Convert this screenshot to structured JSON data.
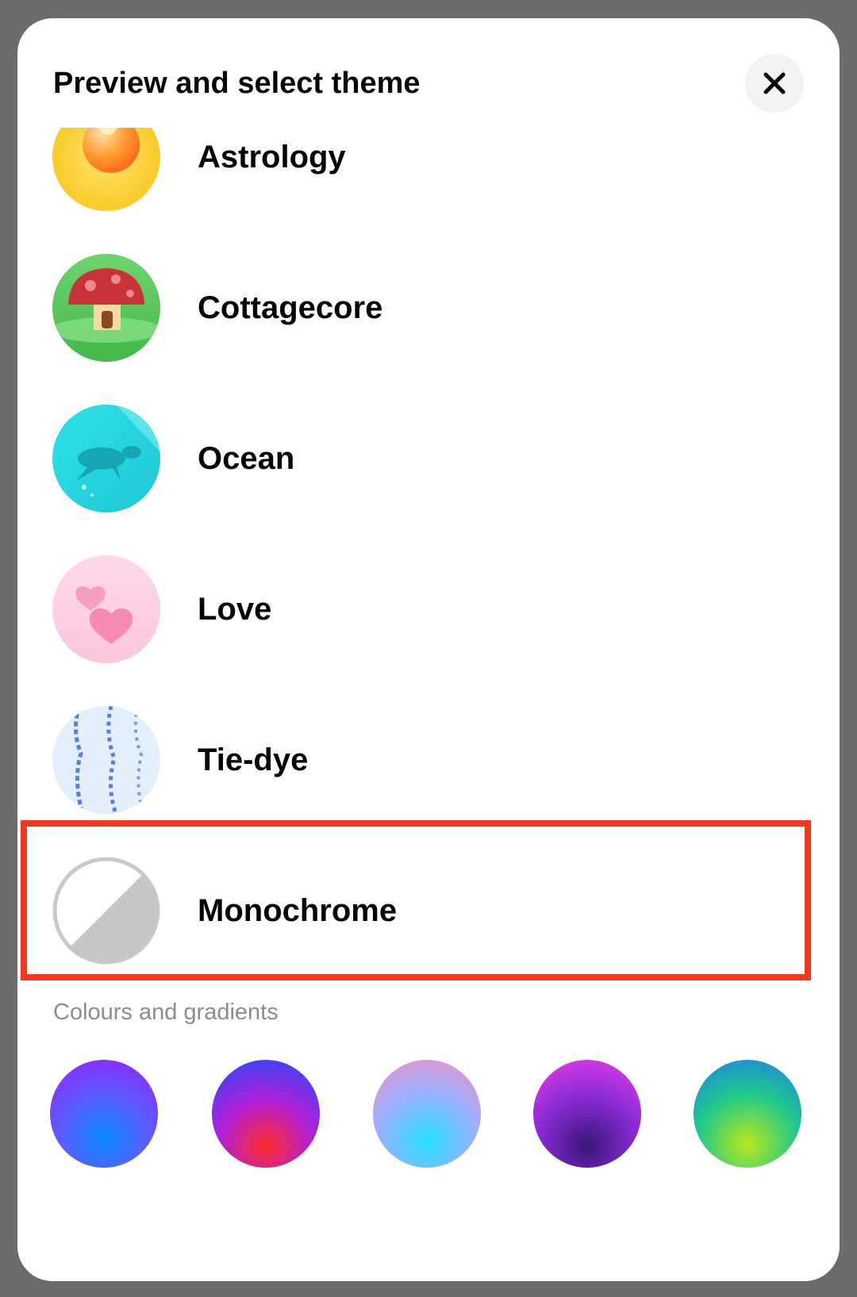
{
  "header": {
    "title": "Preview and select theme"
  },
  "themes": [
    {
      "label": "Astrology",
      "icon": "sun-moon-icon"
    },
    {
      "label": "Cottagecore",
      "icon": "mushroom-house-icon"
    },
    {
      "label": "Ocean",
      "icon": "sea-turtle-icon"
    },
    {
      "label": "Love",
      "icon": "hearts-icon"
    },
    {
      "label": "Tie-dye",
      "icon": "tie-dye-pattern-icon"
    },
    {
      "label": "Monochrome",
      "icon": "half-circle-icon",
      "highlighted": true
    }
  ],
  "colours": {
    "section_title": "Colours and gradients",
    "swatches": [
      {
        "colors": [
          "#9a1cff",
          "#0a8cff"
        ]
      },
      {
        "colors": [
          "#1f4cff",
          "#ff2b2b"
        ]
      },
      {
        "colors": [
          "#f58fc0",
          "#22e0ff"
        ]
      },
      {
        "colors": [
          "#ef3fe6",
          "#3a167a"
        ]
      },
      {
        "colors": [
          "#1c7cf0",
          "#b9e81c"
        ]
      }
    ]
  },
  "accent": {
    "highlight": "#f2391b"
  }
}
